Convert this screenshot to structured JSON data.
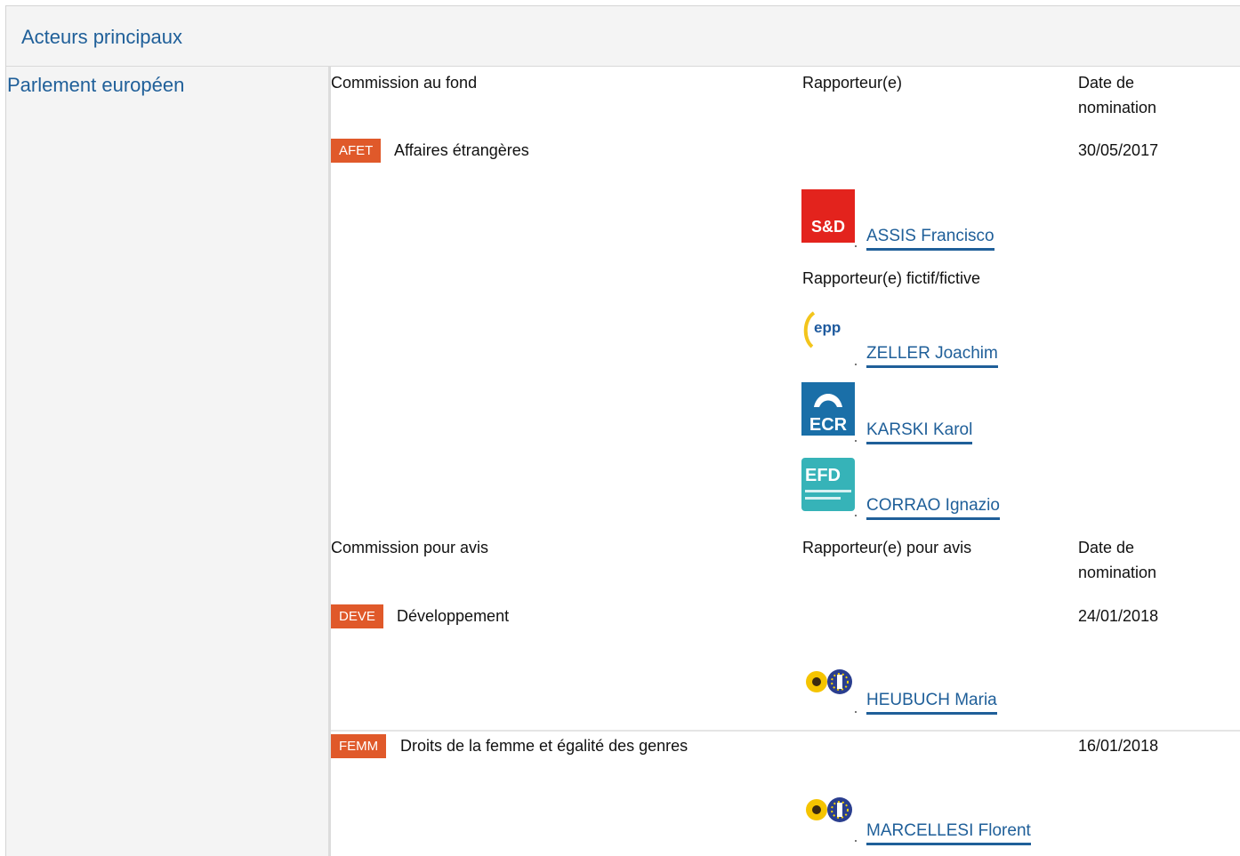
{
  "header": {
    "title": "Acteurs principaux"
  },
  "sidebar": {
    "title": "Parlement européen"
  },
  "lead": {
    "headers": {
      "committee": "Commission au fond",
      "rapporteur": "Rapporteur(e)",
      "date_line1": "Date de",
      "date_line2": "nomination"
    },
    "committee": {
      "code": "AFET",
      "name": "Affaires étrangères",
      "date": "30/05/2017"
    },
    "rapporteur": {
      "group": "S&D",
      "name": "ASSIS Francisco"
    },
    "shadow_label": "Rapporteur(e) fictif/fictive",
    "shadows": [
      {
        "group": "EPP",
        "logo_text": "epp",
        "name": "ZELLER Joachim"
      },
      {
        "group": "ECR",
        "logo_text": "ECR",
        "name": "KARSKI Karol"
      },
      {
        "group": "EFDD",
        "logo_text": "EFD",
        "name": "CORRAO Ignazio"
      }
    ]
  },
  "opinion": {
    "headers": {
      "committee": "Commission pour avis",
      "rapporteur": "Rapporteur(e) pour avis",
      "date_line1": "Date de",
      "date_line2": "nomination"
    },
    "committees": [
      {
        "code": "DEVE",
        "name": "Développement",
        "date": "24/01/2018",
        "rapporteur": {
          "group": "Greens/EFA",
          "name": "HEUBUCH Maria"
        }
      },
      {
        "code": "FEMM",
        "name": "Droits de la femme et égalité des genres",
        "date": "16/01/2018",
        "rapporteur": {
          "group": "Greens/EFA",
          "name": "MARCELLESI Florent"
        }
      }
    ]
  },
  "colors": {
    "badge": "#e0592a",
    "link": "#1f5f99",
    "panel": "#f4f4f4"
  }
}
